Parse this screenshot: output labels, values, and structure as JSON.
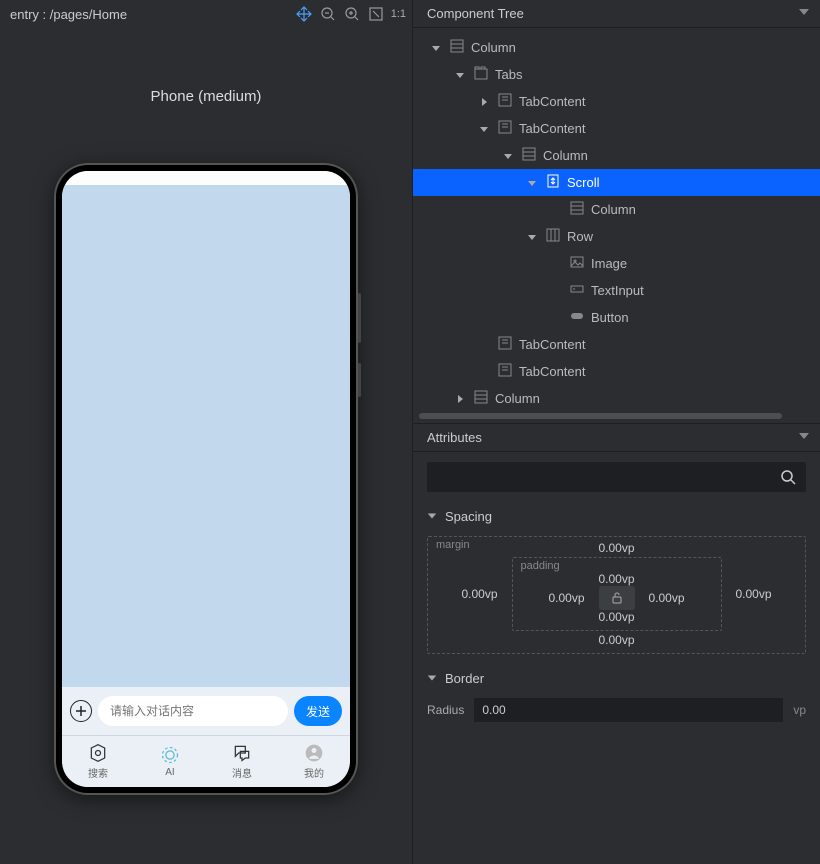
{
  "entry": {
    "title": "entry : /pages/Home",
    "ratio": "1:1"
  },
  "preview": {
    "device_label": "Phone (medium)",
    "input_placeholder": "请输入对话内容",
    "send_label": "发送",
    "tabs": [
      "搜索",
      "AI",
      "消息",
      "我的"
    ]
  },
  "component_tree": {
    "title": "Component Tree",
    "nodes": [
      {
        "depth": 0,
        "icon": "column",
        "label": "Column",
        "twisty": "down"
      },
      {
        "depth": 1,
        "icon": "tabs",
        "label": "Tabs",
        "twisty": "down"
      },
      {
        "depth": 2,
        "icon": "tabcontent",
        "label": "TabContent",
        "twisty": "right"
      },
      {
        "depth": 2,
        "icon": "tabcontent",
        "label": "TabContent",
        "twisty": "down"
      },
      {
        "depth": 3,
        "icon": "column",
        "label": "Column",
        "twisty": "down"
      },
      {
        "depth": 4,
        "icon": "scroll",
        "label": "Scroll",
        "twisty": "down",
        "selected": true
      },
      {
        "depth": 5,
        "icon": "column",
        "label": "Column",
        "twisty": "none"
      },
      {
        "depth": 4,
        "icon": "row",
        "label": "Row",
        "twisty": "down"
      },
      {
        "depth": 5,
        "icon": "image",
        "label": "Image",
        "twisty": "none"
      },
      {
        "depth": 5,
        "icon": "textinput",
        "label": "TextInput",
        "twisty": "none"
      },
      {
        "depth": 5,
        "icon": "button",
        "label": "Button",
        "twisty": "none"
      },
      {
        "depth": 2,
        "icon": "tabcontent",
        "label": "TabContent",
        "twisty": "none"
      },
      {
        "depth": 2,
        "icon": "tabcontent",
        "label": "TabContent",
        "twisty": "none"
      },
      {
        "depth": 1,
        "icon": "column",
        "label": "Column",
        "twisty": "right"
      }
    ]
  },
  "attributes": {
    "title": "Attributes",
    "spacing": {
      "label": "Spacing",
      "margin_label": "margin",
      "padding_label": "padding",
      "margin": {
        "top": "0.00vp",
        "right": "0.00vp",
        "bottom": "0.00vp",
        "left": "0.00vp"
      },
      "padding": {
        "top": "0.00vp",
        "right": "0.00vp",
        "bottom": "0.00vp",
        "left": "0.00vp"
      }
    },
    "border": {
      "label": "Border",
      "radius_label": "Radius",
      "radius_value": "0.00",
      "unit": "vp"
    }
  }
}
